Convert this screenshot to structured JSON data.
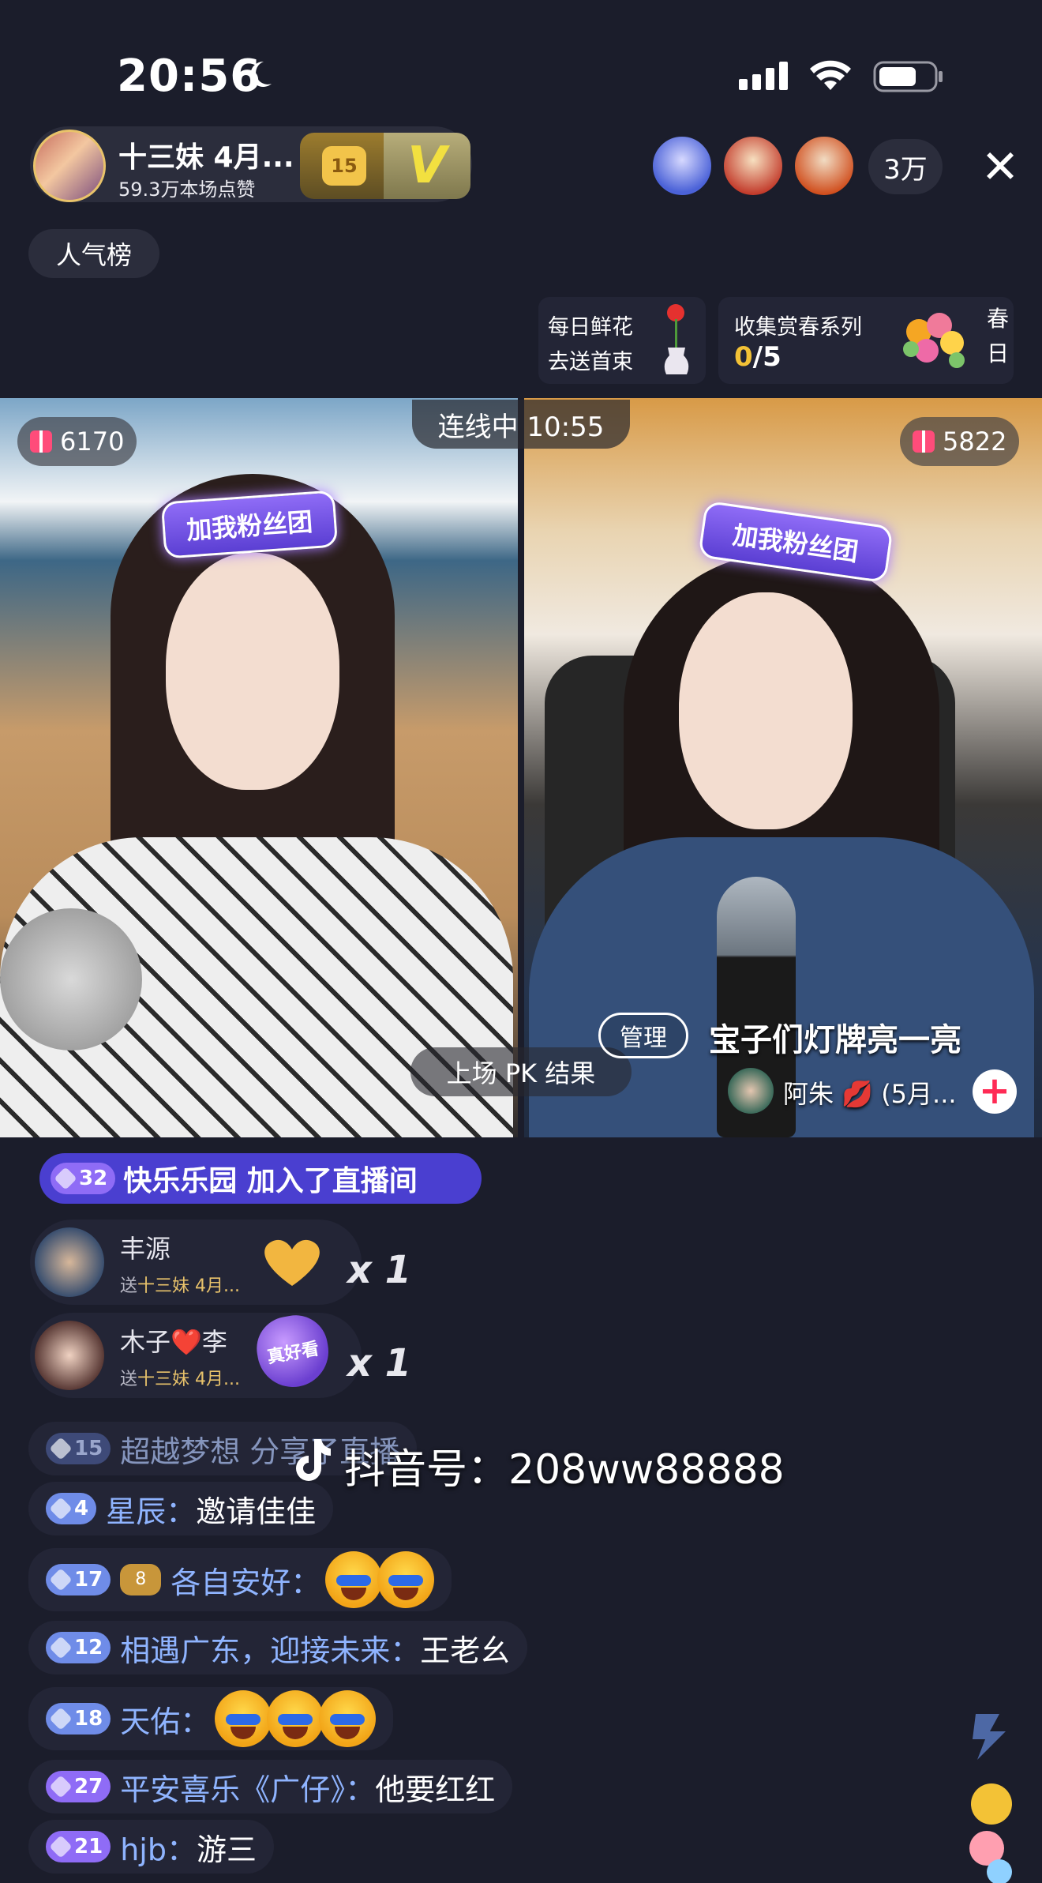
{
  "status_bar": {
    "time": "20:56"
  },
  "header": {
    "host_name": "十三妹 4月...",
    "host_likes": "59.3万本场点赞",
    "fan_level": "15",
    "v_badge": "V",
    "viewer_count": "3万",
    "close": "✕",
    "rank_button": "人气榜"
  },
  "events": {
    "flower_line1": "每日鲜花",
    "flower_line2": "去送首束",
    "spring_line1": "收集赏春系列",
    "spring_progress_done": "0",
    "spring_progress_total": "/5",
    "spring_side": "春日"
  },
  "video": {
    "connect_status": "连线中 10:55",
    "score_left": "6170",
    "score_right": "5822",
    "sticker_left": "加我粉丝团",
    "sticker_right": "加我粉丝团",
    "pk_result": "上场 PK 结果",
    "admin_tag": "管理",
    "admin_message": "宝子们灯牌亮一亮",
    "guest_name": "阿朱 💋 (5月...",
    "follow_icon": "+"
  },
  "comments": {
    "join": {
      "level": "32",
      "text": "快乐乐园 加入了直播间"
    },
    "gifts": [
      {
        "user": "丰源",
        "to_prefix": "送",
        "to_name": "十三妹 4月...",
        "count": "x 1"
      },
      {
        "user": "木子❤️李",
        "to_prefix": "送",
        "to_name": "十三妹 4月...",
        "count": "x 1",
        "gift_text": "真好看"
      }
    ],
    "share": {
      "level": "15",
      "user": "超越梦想",
      "text": "分享了直播"
    },
    "messages": [
      {
        "level": "4",
        "user": "星辰：",
        "text": "邀请佳佳"
      },
      {
        "level": "17",
        "badge": "8",
        "user": "各自安好：",
        "text": ""
      },
      {
        "level": "12",
        "user": "相遇广东，迎接未来：",
        "text": "王老幺"
      },
      {
        "level": "18",
        "user": "天佑：",
        "text": ""
      },
      {
        "level": "27",
        "user": "平安喜乐《广仔》：",
        "text": "他要红红"
      },
      {
        "level": "21",
        "user": "hjb：",
        "text": "游三"
      }
    ]
  },
  "watermark": "抖音号：208ww88888",
  "colors": {
    "background": "#1b1d2b",
    "accent_gold": "#f3c236",
    "level_blue": "#6f8ce8",
    "level_purple": "#8f6cf6",
    "join_pill": "#4a3fd0",
    "follow_red": "#ff2b55"
  }
}
